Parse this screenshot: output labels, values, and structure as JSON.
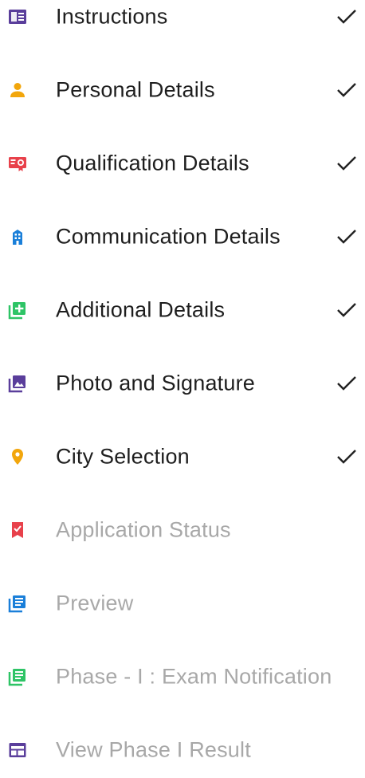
{
  "menu": {
    "items": [
      {
        "label": "Instructions",
        "icon": "instructions-book-icon",
        "icon_color": "#5a3e9b",
        "completed": true
      },
      {
        "label": "Personal Details",
        "icon": "person-icon",
        "icon_color": "#f2a60c",
        "completed": true
      },
      {
        "label": "Qualification Details",
        "icon": "certificate-icon",
        "icon_color": "#e8414b",
        "completed": true
      },
      {
        "label": "Communication Details",
        "icon": "building-icon",
        "icon_color": "#1a7fd9",
        "completed": true
      },
      {
        "label": "Additional Details",
        "icon": "add-box-icon",
        "icon_color": "#2ec466",
        "completed": true
      },
      {
        "label": "Photo and Signature",
        "icon": "photo-library-icon",
        "icon_color": "#5a3e9b",
        "completed": true
      },
      {
        "label": "City Selection",
        "icon": "location-pin-icon",
        "icon_color": "#f2a60c",
        "completed": true
      },
      {
        "label": "Application Status",
        "icon": "bookmark-check-icon",
        "icon_color": "#e8414b",
        "completed": false
      },
      {
        "label": "Preview",
        "icon": "document-stack-icon",
        "icon_color": "#1a7fd9",
        "completed": false
      },
      {
        "label": "Phase - I : Exam Notification",
        "icon": "notification-document-icon",
        "icon_color": "#2ec466",
        "completed": false
      },
      {
        "label": "View Phase I Result",
        "icon": "result-table-icon",
        "icon_color": "#5a3e9b",
        "completed": false
      }
    ],
    "check_icon": "checkmark-icon",
    "text_color_active": "#1e1e1e",
    "text_color_inactive": "#a8a8a8"
  }
}
